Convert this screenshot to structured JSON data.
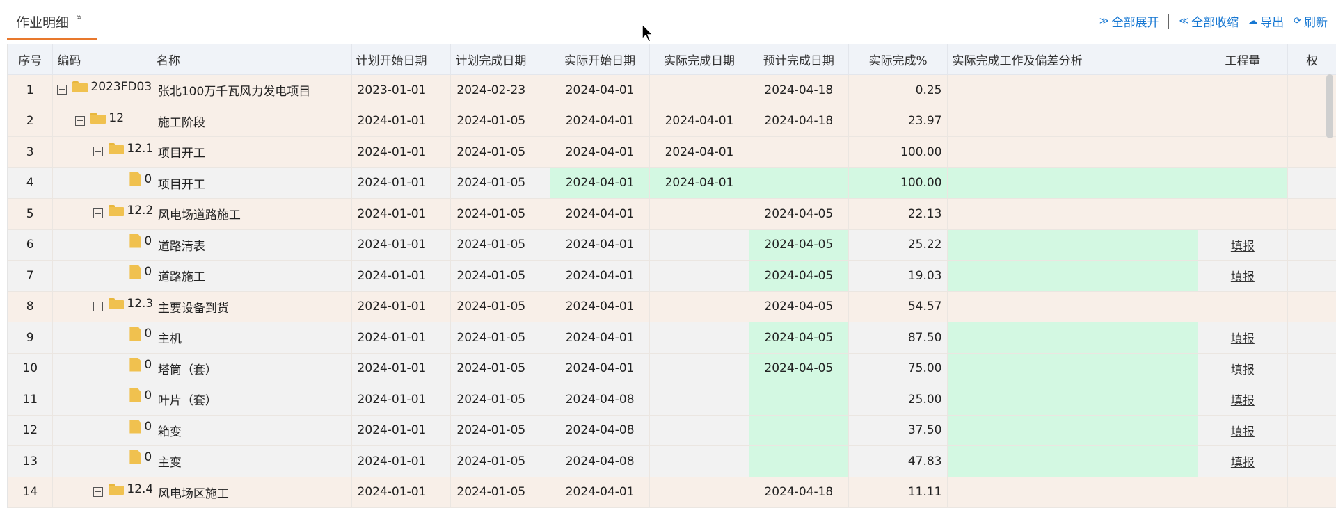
{
  "tab": {
    "label": "作业明细",
    "chevron": "»"
  },
  "actions": {
    "expand_all": "全部展开",
    "collapse_all": "全部收缩",
    "export": "导出",
    "refresh": "刷新"
  },
  "columns": {
    "seq": "序号",
    "code": "编码",
    "name": "名称",
    "plan_start": "计划开始日期",
    "plan_end": "计划完成日期",
    "act_start": "实际开始日期",
    "act_end": "实际完成日期",
    "est_end": "预计完成日期",
    "pct": "实际完成%",
    "analysis": "实际完成工作及偏差分析",
    "quantity": "工程量",
    "weight": "权"
  },
  "rows": [
    {
      "seq": "1",
      "code": "2023FD03",
      "name": "张北100万千瓦风力发电项目",
      "plan_start": "2023-01-01",
      "plan_end": "2024-02-23",
      "act_start": "2024-04-01",
      "act_end": "",
      "est_end": "2024-04-18",
      "pct": "0.25",
      "report": ""
    },
    {
      "seq": "2",
      "code": "12",
      "name": "施工阶段",
      "plan_start": "2024-01-01",
      "plan_end": "2024-01-05",
      "act_start": "2024-04-01",
      "act_end": "2024-04-01",
      "est_end": "2024-04-18",
      "pct": "23.97",
      "report": ""
    },
    {
      "seq": "3",
      "code": "12.1",
      "name": "项目开工",
      "plan_start": "2024-01-01",
      "plan_end": "2024-01-05",
      "act_start": "2024-04-01",
      "act_end": "2024-04-01",
      "est_end": "",
      "pct": "100.00",
      "report": ""
    },
    {
      "seq": "4",
      "code": "0",
      "name": "项目开工",
      "plan_start": "2024-01-01",
      "plan_end": "2024-01-05",
      "act_start": "2024-04-01",
      "act_end": "2024-04-01",
      "est_end": "",
      "pct": "100.00",
      "report": ""
    },
    {
      "seq": "5",
      "code": "12.2",
      "name": "风电场道路施工",
      "plan_start": "2024-01-01",
      "plan_end": "2024-01-05",
      "act_start": "2024-04-01",
      "act_end": "",
      "est_end": "2024-04-05",
      "pct": "22.13",
      "report": ""
    },
    {
      "seq": "6",
      "code": "0",
      "name": "道路清表",
      "plan_start": "2024-01-01",
      "plan_end": "2024-01-05",
      "act_start": "2024-04-01",
      "act_end": "",
      "est_end": "2024-04-05",
      "pct": "25.22",
      "report": "填报"
    },
    {
      "seq": "7",
      "code": "0",
      "name": "道路施工",
      "plan_start": "2024-01-01",
      "plan_end": "2024-01-05",
      "act_start": "2024-04-01",
      "act_end": "",
      "est_end": "2024-04-05",
      "pct": "19.03",
      "report": "填报"
    },
    {
      "seq": "8",
      "code": "12.3",
      "name": "主要设备到货",
      "plan_start": "2024-01-01",
      "plan_end": "2024-01-05",
      "act_start": "2024-04-01",
      "act_end": "",
      "est_end": "2024-04-05",
      "pct": "54.57",
      "report": ""
    },
    {
      "seq": "9",
      "code": "0",
      "name": "主机",
      "plan_start": "2024-01-01",
      "plan_end": "2024-01-05",
      "act_start": "2024-04-01",
      "act_end": "",
      "est_end": "2024-04-05",
      "pct": "87.50",
      "report": "填报"
    },
    {
      "seq": "10",
      "code": "0",
      "name": "塔筒（套）",
      "plan_start": "2024-01-01",
      "plan_end": "2024-01-05",
      "act_start": "2024-04-01",
      "act_end": "",
      "est_end": "2024-04-05",
      "pct": "75.00",
      "report": "填报"
    },
    {
      "seq": "11",
      "code": "0",
      "name": "叶片（套）",
      "plan_start": "2024-01-01",
      "plan_end": "2024-01-05",
      "act_start": "2024-04-08",
      "act_end": "",
      "est_end": "",
      "pct": "25.00",
      "report": "填报"
    },
    {
      "seq": "12",
      "code": "0",
      "name": "箱变",
      "plan_start": "2024-01-01",
      "plan_end": "2024-01-05",
      "act_start": "2024-04-08",
      "act_end": "",
      "est_end": "",
      "pct": "37.50",
      "report": "填报"
    },
    {
      "seq": "13",
      "code": "0",
      "name": "主变",
      "plan_start": "2024-01-01",
      "plan_end": "2024-01-05",
      "act_start": "2024-04-08",
      "act_end": "",
      "est_end": "",
      "pct": "47.83",
      "report": "填报"
    },
    {
      "seq": "14",
      "code": "12.4",
      "name": "风电场区施工",
      "plan_start": "2024-01-01",
      "plan_end": "2024-01-05",
      "act_start": "2024-04-01",
      "act_end": "",
      "est_end": "2024-04-18",
      "pct": "11.11",
      "report": ""
    }
  ]
}
